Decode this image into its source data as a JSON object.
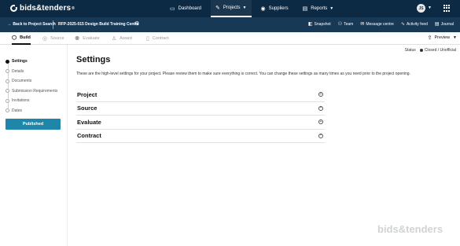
{
  "app": {
    "logo_text": "bids&tenders",
    "logo_mark": "®",
    "avatar_initials": "JS"
  },
  "nav": [
    {
      "label": "Dashboard",
      "icon": "dashboard-icon",
      "glyph": "▭",
      "active": false,
      "chevron": false
    },
    {
      "label": "Projects",
      "icon": "edit-icon",
      "glyph": "✎",
      "active": true,
      "chevron": true
    },
    {
      "label": "Suppliers",
      "icon": "user-icon",
      "glyph": "◉",
      "active": false,
      "chevron": false
    },
    {
      "label": "Reports",
      "icon": "report-icon",
      "glyph": "▤",
      "active": false,
      "chevron": true
    }
  ],
  "subbar": {
    "back_label": "Back to Project Search",
    "project_name": "RFP-2025-015 Design Build Training Centre",
    "tools": [
      {
        "label": "Snapshot",
        "icon": "camera-icon",
        "glyph": "◧"
      },
      {
        "label": "Team",
        "icon": "team-icon",
        "glyph": "⚇"
      },
      {
        "label": "Message centre",
        "icon": "message-icon",
        "glyph": "✉"
      },
      {
        "label": "Activity feed",
        "icon": "activity-icon",
        "glyph": "∿"
      },
      {
        "label": "Journal",
        "icon": "journal-icon",
        "glyph": "▤"
      }
    ]
  },
  "tabs": [
    {
      "label": "Build",
      "icon": "build-icon",
      "glyph": "⬡",
      "active": true
    },
    {
      "label": "Source",
      "icon": "source-icon",
      "glyph": "◎",
      "active": false
    },
    {
      "label": "Evaluate",
      "icon": "evaluate-icon",
      "glyph": "⚉",
      "active": false
    },
    {
      "label": "Award",
      "icon": "award-icon",
      "glyph": "♙",
      "active": false
    },
    {
      "label": "Contract",
      "icon": "contract-icon",
      "glyph": "▯",
      "active": false
    }
  ],
  "preview_label": "Preview",
  "status": {
    "label": "Status",
    "value": "Closed / Unofficial"
  },
  "steps": [
    {
      "label": "Settings",
      "active": true
    },
    {
      "label": "Details",
      "active": false
    },
    {
      "label": "Documents",
      "active": false
    },
    {
      "label": "Submission Requirements",
      "active": false
    },
    {
      "label": "Invitations",
      "active": false
    },
    {
      "label": "Dates",
      "active": false
    }
  ],
  "published_label": "Published",
  "page": {
    "title": "Settings",
    "description": "These are the high-level settings for your project. Please review them to make sure everything is correct. You can change these settings as many times as you need prior to the project opening."
  },
  "sections": [
    {
      "label": "Project"
    },
    {
      "label": "Source"
    },
    {
      "label": "Evaluate"
    },
    {
      "label": "Contract"
    }
  ],
  "footer": {
    "watermark": "bids&tenders"
  },
  "colors": {
    "nav_bg": "#0d2a45",
    "subbar_bg": "#183955",
    "accent": "#1e86a8"
  }
}
